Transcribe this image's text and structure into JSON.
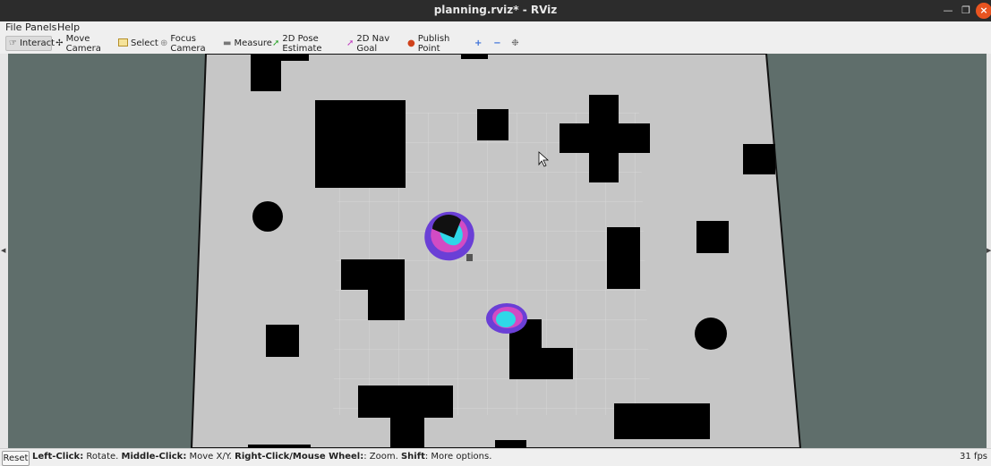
{
  "window": {
    "title": "planning.rviz* - RViz"
  },
  "menu": {
    "file": "File",
    "panels": "Panels",
    "help": "Help"
  },
  "toolbar": {
    "interact": "Interact",
    "move_camera": "Move Camera",
    "select": "Select",
    "focus_camera": "Focus Camera",
    "measure": "Measure",
    "pose_estimate": "2D Pose Estimate",
    "nav_goal": "2D Nav Goal",
    "publish_point": "Publish Point"
  },
  "status": {
    "reset": "Reset",
    "k1": "Left-Click:",
    "v1": " Rotate. ",
    "k2": "Middle-Click:",
    "v2": " Move X/Y. ",
    "k3": "Right-Click/Mouse Wheel:",
    "v3": ": Zoom. ",
    "k4": "Shift",
    "v4": ": More options.",
    "fps": "31 fps"
  },
  "colors": {
    "background": "#5f6e6b",
    "floor": "#c6c6c6",
    "obstacle": "#000000",
    "costmap_outer": "#6a3fd6",
    "costmap_mid": "#d24bc4",
    "costmap_inner": "#2fd8e8",
    "accent_close": "#e95420"
  },
  "icons": [
    "minimize-icon",
    "maximize-icon",
    "close-icon",
    "interact-icon",
    "move-camera-icon",
    "select-icon",
    "focus-camera-icon",
    "measure-icon",
    "pose-estimate-icon",
    "nav-goal-icon",
    "publish-point-icon",
    "zoom-in-icon",
    "zoom-out-icon",
    "camera-settings-icon"
  ]
}
